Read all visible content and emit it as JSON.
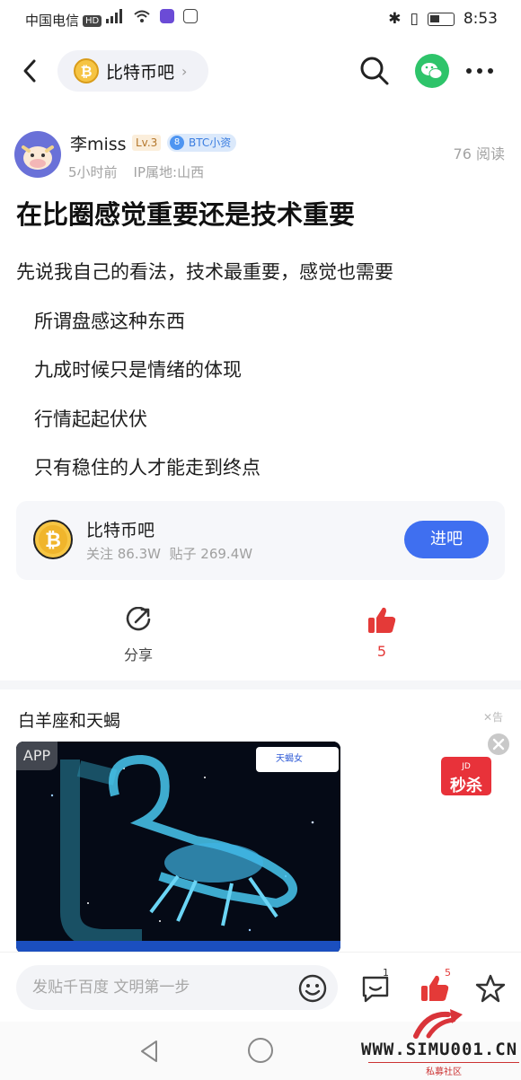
{
  "status_bar": {
    "carrier": "中国电信",
    "hd": "HD",
    "time": "8:53"
  },
  "nav": {
    "forum_name": "比特币吧",
    "chevron": "›"
  },
  "post": {
    "author": "李miss",
    "level": "Lv.3",
    "badge_number": "8",
    "badge_label": "BTC小资",
    "time_ago": "5小时前",
    "ip_location": "IP属地:山西",
    "views": "76 阅读",
    "title": "在比圈感觉重要还是技术重要",
    "lines": [
      "先说我自己的看法，技术最重要，感觉也需要",
      "所谓盘感这种东西",
      "九成时候只是情绪的体现",
      "行情起起伏伏",
      "只有稳住的人才能走到终点"
    ]
  },
  "forum_card": {
    "name": "比特币吧",
    "stats": "关注 86.3W  贴子 269.4W",
    "enter_label": "进吧"
  },
  "actions": {
    "share_label": "分享",
    "like_count": "5"
  },
  "ad": {
    "title": "白羊座和天蝎",
    "close_tag": "✕告",
    "app_tag": "APP",
    "brand": "天蝎女",
    "promo_jd": "JD",
    "promo_text": "秒杀"
  },
  "reply_bar": {
    "placeholder": "发贴千百度 文明第一步",
    "comment_count": "1",
    "like_count": "5"
  },
  "watermark": {
    "text": "WWW.SIMU001.CN",
    "sub": "私募社区"
  },
  "colors": {
    "accent_blue": "#3f6ff0",
    "like_red": "#e43a38",
    "wechat_green": "#2ec46a"
  },
  "icons": [
    "back-icon",
    "bitcoin-icon",
    "search-icon",
    "wechat-icon",
    "more-icon",
    "share-icon",
    "thumbs-up-icon",
    "emoji-icon",
    "comment-icon",
    "star-icon"
  ]
}
